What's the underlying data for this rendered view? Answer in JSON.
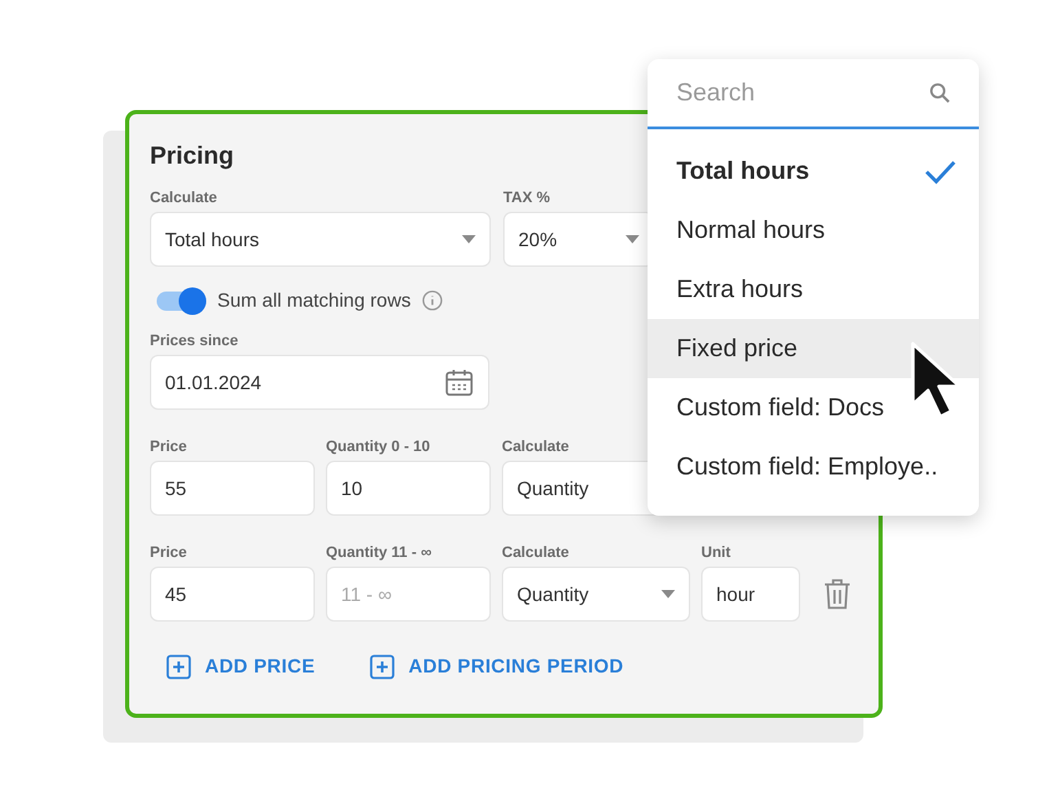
{
  "pricing": {
    "title": "Pricing",
    "calculate": {
      "label": "Calculate",
      "value": "Total hours"
    },
    "tax": {
      "label": "TAX %",
      "value": "20%"
    },
    "sum_toggle": {
      "label": "Sum all matching rows",
      "on": true
    },
    "prices_since": {
      "label": "Prices since",
      "value": "01.01.2024"
    },
    "rows": [
      {
        "price_label": "Price",
        "price": "55",
        "quantity_label": "Quantity 0 - 10",
        "quantity": "10",
        "calculate_label": "Calculate",
        "calculate": "Quantity"
      },
      {
        "price_label": "Price",
        "price": "45",
        "quantity_label": "Quantity 11 - ∞",
        "quantity_placeholder": "11 - ∞",
        "calculate_label": "Calculate",
        "calculate": "Quantity",
        "unit_label": "Unit",
        "unit": "hour"
      }
    ],
    "actions": [
      "ADD PRICE",
      "ADD PRICING PERIOD"
    ]
  },
  "dropdown": {
    "search": {
      "placeholder": "Search"
    },
    "options": [
      {
        "label": "Total hours",
        "selected": true,
        "hovered": false
      },
      {
        "label": "Normal hours",
        "selected": false,
        "hovered": false
      },
      {
        "label": "Extra hours",
        "selected": false,
        "hovered": false
      },
      {
        "label": "Fixed price",
        "selected": false,
        "hovered": true
      },
      {
        "label": "Custom field: Docs",
        "selected": false,
        "hovered": false
      },
      {
        "label": "Custom field: Employe..",
        "selected": false,
        "hovered": false
      }
    ]
  }
}
